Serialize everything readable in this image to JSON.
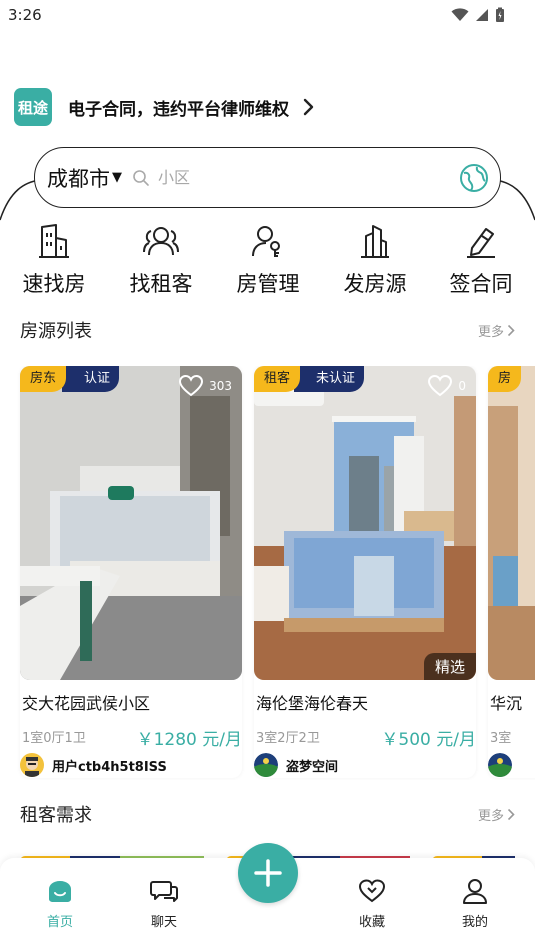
{
  "status_bar": {
    "time": "3:26"
  },
  "promo": {
    "logo_text": "租途",
    "text": "电子合同，违约平台律师维权"
  },
  "search": {
    "city": "成都市",
    "placeholder": "小区"
  },
  "quick_actions": [
    {
      "label": "速找房",
      "icon": "building-icon"
    },
    {
      "label": "找租客",
      "icon": "people-icon"
    },
    {
      "label": "房管理",
      "icon": "user-key-icon"
    },
    {
      "label": "发房源",
      "icon": "tower-icon"
    },
    {
      "label": "签合同",
      "icon": "pen-sign-icon"
    }
  ],
  "listings_section": {
    "title": "房源列表",
    "more": "更多"
  },
  "listings": [
    {
      "role": "房东",
      "verify": "认证",
      "likes": "303",
      "featured": "",
      "title": "交大花园武侯小区",
      "layout": "1室0厅1卫",
      "price": "￥1280 元/月",
      "owner": "用户ctb4h5t8ISS"
    },
    {
      "role": "租客",
      "verify": "未认证",
      "likes": "0",
      "featured": "精选",
      "title": "海伦堡海伦春天",
      "layout": "3室2厅2卫",
      "price": "￥500 元/月",
      "owner": "盗梦空间"
    },
    {
      "role": "房",
      "verify": "",
      "likes": "",
      "featured": "",
      "title": "华沉",
      "layout": "3室",
      "price": "",
      "owner": ""
    }
  ],
  "demand_section": {
    "title": "租客需求",
    "more": "更多"
  },
  "tabbar": {
    "items": [
      {
        "label": "首页",
        "icon": "home-icon",
        "active": true
      },
      {
        "label": "聊天",
        "icon": "chat-icon",
        "active": false
      },
      {
        "label": "收藏",
        "icon": "heart-icon",
        "active": false
      },
      {
        "label": "我的",
        "icon": "profile-icon",
        "active": false
      }
    ]
  },
  "colors": {
    "accent": "#3aaea4",
    "tag_yellow": "#f5b81c",
    "tag_navy": "#1d2f6b",
    "price": "#3aaea4"
  }
}
